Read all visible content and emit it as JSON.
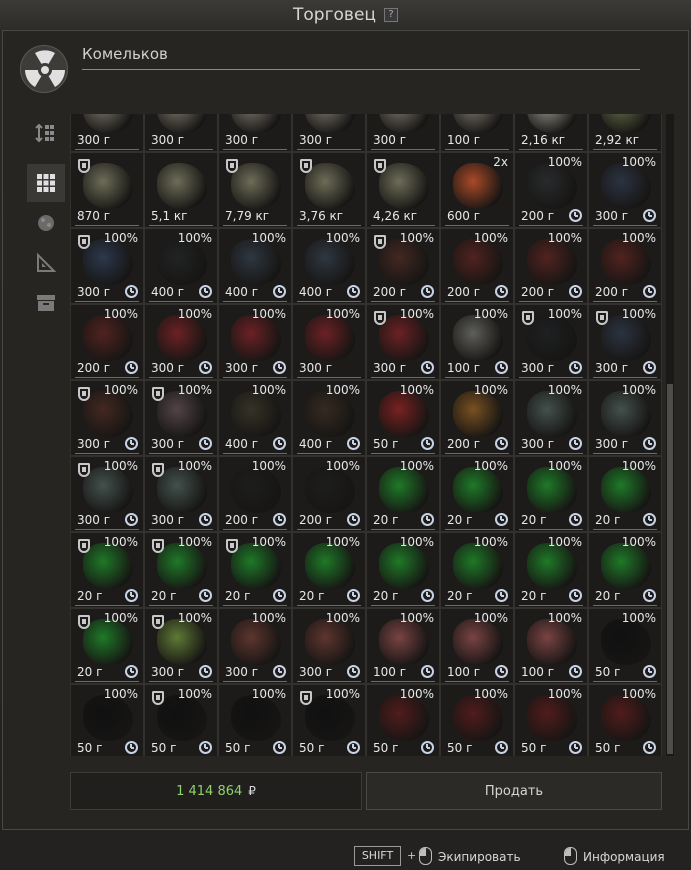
{
  "window": {
    "title": "Торговец",
    "help": "?"
  },
  "trader": {
    "name": "Комельков"
  },
  "sidebar": {
    "icons": [
      "sort-icon",
      "grid-icon",
      "artifact-icon",
      "drawing-icon",
      "container-icon"
    ]
  },
  "colors": {
    "money": "#8fd16a",
    "clock": "#c9d3e6"
  },
  "items": [
    {
      "w": "300 г",
      "pct": "",
      "shield": false,
      "clock": false,
      "c": "#8a8376"
    },
    {
      "w": "300 г",
      "pct": "",
      "shield": false,
      "clock": false,
      "c": "#8a8376"
    },
    {
      "w": "300 г",
      "pct": "",
      "shield": false,
      "clock": false,
      "c": "#8a8376"
    },
    {
      "w": "300 г",
      "pct": "",
      "shield": false,
      "clock": false,
      "c": "#8a8376"
    },
    {
      "w": "300 г",
      "pct": "",
      "shield": false,
      "clock": false,
      "c": "#8a8376"
    },
    {
      "w": "100 г",
      "pct": "",
      "shield": false,
      "clock": false,
      "c": "#8a8376"
    },
    {
      "w": "2,16 кг",
      "pct": "",
      "shield": false,
      "clock": false,
      "c": "#a9a59c"
    },
    {
      "w": "2,92 кг",
      "pct": "",
      "shield": false,
      "clock": false,
      "c": "#6e7550"
    },
    {
      "w": "870 г",
      "pct": "",
      "shield": true,
      "clock": false,
      "c": "#7c7b63"
    },
    {
      "w": "5,1 кг",
      "pct": "",
      "shield": false,
      "clock": false,
      "c": "#7c7b63"
    },
    {
      "w": "7,79 кг",
      "pct": "",
      "shield": true,
      "clock": false,
      "c": "#7c7b63"
    },
    {
      "w": "3,76 кг",
      "pct": "",
      "shield": true,
      "clock": false,
      "c": "#7c7b63"
    },
    {
      "w": "4,26 кг",
      "pct": "",
      "shield": true,
      "clock": false,
      "c": "#7c7b63"
    },
    {
      "w": "600 г",
      "pct": "2x",
      "shield": false,
      "clock": false,
      "c": "#c4522a"
    },
    {
      "w": "200 г",
      "pct": "100%",
      "shield": false,
      "clock": true,
      "c": "#2b2d30"
    },
    {
      "w": "300 г",
      "pct": "100%",
      "shield": false,
      "clock": true,
      "c": "#2e3748"
    },
    {
      "w": "300 г",
      "pct": "100%",
      "shield": true,
      "clock": true,
      "c": "#2f3d55"
    },
    {
      "w": "400 г",
      "pct": "100%",
      "shield": false,
      "clock": true,
      "c": "#222426"
    },
    {
      "w": "400 г",
      "pct": "100%",
      "shield": false,
      "clock": true,
      "c": "#323c48"
    },
    {
      "w": "400 г",
      "pct": "100%",
      "shield": false,
      "clock": true,
      "c": "#323c48"
    },
    {
      "w": "200 г",
      "pct": "100%",
      "shield": true,
      "clock": true,
      "c": "#4a2a22"
    },
    {
      "w": "200 г",
      "pct": "100%",
      "shield": false,
      "clock": true,
      "c": "#5a2420"
    },
    {
      "w": "200 г",
      "pct": "100%",
      "shield": false,
      "clock": true,
      "c": "#5a2420"
    },
    {
      "w": "200 г",
      "pct": "100%",
      "shield": false,
      "clock": true,
      "c": "#5a2420"
    },
    {
      "w": "200 г",
      "pct": "100%",
      "shield": false,
      "clock": true,
      "c": "#5a2420"
    },
    {
      "w": "300 г",
      "pct": "100%",
      "shield": false,
      "clock": true,
      "c": "#7a2226"
    },
    {
      "w": "300 г",
      "pct": "100%",
      "shield": false,
      "clock": true,
      "c": "#7a2226"
    },
    {
      "w": "300 г",
      "pct": "100%",
      "shield": false,
      "clock": false,
      "c": "#7a2226"
    },
    {
      "w": "300 г",
      "pct": "100%",
      "shield": true,
      "clock": true,
      "c": "#7a2226"
    },
    {
      "w": "100 г",
      "pct": "100%",
      "shield": false,
      "clock": true,
      "c": "#6a6a66"
    },
    {
      "w": "300 г",
      "pct": "100%",
      "shield": true,
      "clock": true,
      "c": "#1f2124"
    },
    {
      "w": "300 г",
      "pct": "100%",
      "shield": true,
      "clock": true,
      "c": "#2e3748"
    },
    {
      "w": "300 г",
      "pct": "100%",
      "shield": true,
      "clock": true,
      "c": "#4a2a22"
    },
    {
      "w": "300 г",
      "pct": "100%",
      "shield": true,
      "clock": true,
      "c": "#5b4b4e"
    },
    {
      "w": "400 г",
      "pct": "100%",
      "shield": false,
      "clock": true,
      "c": "#3a3628"
    },
    {
      "w": "400 г",
      "pct": "100%",
      "shield": false,
      "clock": true,
      "c": "#3a2c22"
    },
    {
      "w": "50 г",
      "pct": "100%",
      "shield": false,
      "clock": true,
      "c": "#8a2222"
    },
    {
      "w": "200 г",
      "pct": "100%",
      "shield": false,
      "clock": true,
      "c": "#8a5a22"
    },
    {
      "w": "300 г",
      "pct": "100%",
      "shield": false,
      "clock": true,
      "c": "#4a5a56"
    },
    {
      "w": "300 г",
      "pct": "100%",
      "shield": false,
      "clock": true,
      "c": "#4a5a56"
    },
    {
      "w": "300 г",
      "pct": "100%",
      "shield": true,
      "clock": true,
      "c": "#4a5a56"
    },
    {
      "w": "300 г",
      "pct": "100%",
      "shield": true,
      "clock": true,
      "c": "#4a5a56"
    },
    {
      "w": "200 г",
      "pct": "100%",
      "shield": false,
      "clock": true,
      "c": "#1e1e1e"
    },
    {
      "w": "200 г",
      "pct": "100%",
      "shield": false,
      "clock": true,
      "c": "#1e1e1e"
    },
    {
      "w": "20 г",
      "pct": "100%",
      "shield": false,
      "clock": true,
      "c": "#1f8a2a"
    },
    {
      "w": "20 г",
      "pct": "100%",
      "shield": false,
      "clock": true,
      "c": "#1f8a2a"
    },
    {
      "w": "20 г",
      "pct": "100%",
      "shield": false,
      "clock": true,
      "c": "#1f8a2a"
    },
    {
      "w": "20 г",
      "pct": "100%",
      "shield": false,
      "clock": true,
      "c": "#1f8a2a"
    },
    {
      "w": "20 г",
      "pct": "100%",
      "shield": true,
      "clock": true,
      "c": "#1f8a2a"
    },
    {
      "w": "20 г",
      "pct": "100%",
      "shield": true,
      "clock": true,
      "c": "#1f8a2a"
    },
    {
      "w": "20 г",
      "pct": "100%",
      "shield": true,
      "clock": true,
      "c": "#1f8a2a"
    },
    {
      "w": "20 г",
      "pct": "100%",
      "shield": false,
      "clock": true,
      "c": "#1f8a2a"
    },
    {
      "w": "20 г",
      "pct": "100%",
      "shield": false,
      "clock": true,
      "c": "#1f8a2a"
    },
    {
      "w": "20 г",
      "pct": "100%",
      "shield": false,
      "clock": true,
      "c": "#1f8a2a"
    },
    {
      "w": "20 г",
      "pct": "100%",
      "shield": false,
      "clock": true,
      "c": "#1f8a2a"
    },
    {
      "w": "20 г",
      "pct": "100%",
      "shield": false,
      "clock": true,
      "c": "#1f8a2a"
    },
    {
      "w": "20 г",
      "pct": "100%",
      "shield": true,
      "clock": true,
      "c": "#1f8a2a"
    },
    {
      "w": "300 г",
      "pct": "100%",
      "shield": true,
      "clock": true,
      "c": "#6a8a3a"
    },
    {
      "w": "300 г",
      "pct": "100%",
      "shield": false,
      "clock": true,
      "c": "#6a3a32"
    },
    {
      "w": "300 г",
      "pct": "100%",
      "shield": false,
      "clock": true,
      "c": "#6a3a32"
    },
    {
      "w": "100 г",
      "pct": "100%",
      "shield": false,
      "clock": true,
      "c": "#8a4a4a"
    },
    {
      "w": "100 г",
      "pct": "100%",
      "shield": false,
      "clock": true,
      "c": "#8a4a4a"
    },
    {
      "w": "100 г",
      "pct": "100%",
      "shield": false,
      "clock": true,
      "c": "#8a4a4a"
    },
    {
      "w": "50 г",
      "pct": "100%",
      "shield": false,
      "clock": true,
      "c": "#0e0e10"
    },
    {
      "w": "50 г",
      "pct": "100%",
      "shield": false,
      "clock": true,
      "c": "#0e0e10"
    },
    {
      "w": "50 г",
      "pct": "100%",
      "shield": true,
      "clock": true,
      "c": "#0e0e10"
    },
    {
      "w": "50 г",
      "pct": "100%",
      "shield": false,
      "clock": true,
      "c": "#0e0e10"
    },
    {
      "w": "50 г",
      "pct": "100%",
      "shield": true,
      "clock": true,
      "c": "#0e0e10"
    },
    {
      "w": "50 г",
      "pct": "100%",
      "shield": false,
      "clock": true,
      "c": "#5a1c1c"
    },
    {
      "w": "50 г",
      "pct": "100%",
      "shield": false,
      "clock": true,
      "c": "#5a1c1c"
    },
    {
      "w": "50 г",
      "pct": "100%",
      "shield": false,
      "clock": true,
      "c": "#5a1c1c"
    },
    {
      "w": "50 г",
      "pct": "100%",
      "shield": false,
      "clock": true,
      "c": "#5a1c1c"
    }
  ],
  "footer": {
    "money": "1 414 864",
    "currency": "₽",
    "sell_label": "Продать"
  },
  "hints": {
    "shift": "SHIFT",
    "plus": "+",
    "equip": "Экипировать",
    "info": "Информация"
  }
}
